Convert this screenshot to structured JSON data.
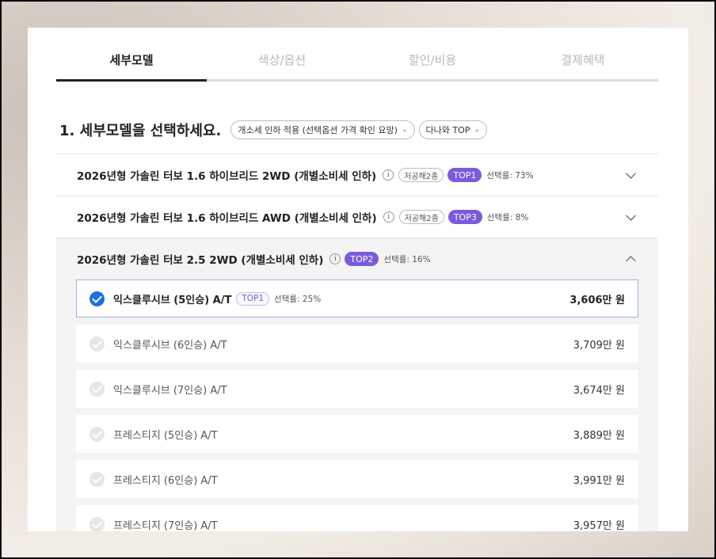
{
  "tabs": [
    {
      "label": "세부모델",
      "active": true
    },
    {
      "label": "색상/옵션",
      "active": false
    },
    {
      "label": "할인/비용",
      "active": false
    },
    {
      "label": "결제혜택",
      "active": false
    }
  ],
  "section": {
    "title": "1. 세부모델을 선택하세요.",
    "filter_tax": "개소세 인하 적용 (선택옵션 가격 확인 요망)",
    "filter_sort": "다나와 TOP"
  },
  "models": [
    {
      "name": "2026년형 가솔린 터보 1.6 하이브리드 2WD (개별소비세 인하)",
      "low_emission": "저공해2종",
      "top": "TOP1",
      "rate": "선택률: 73%"
    },
    {
      "name": "2026년형 가솔린 터보 1.6 하이브리드 AWD (개별소비세 인하)",
      "low_emission": "저공해2종",
      "top": "TOP3",
      "rate": "선택률: 8%"
    },
    {
      "name": "2026년형 가솔린 터보 2.5 2WD (개별소비세 인하)",
      "top": "TOP2",
      "rate": "선택률: 16%"
    }
  ],
  "info_glyph": "i",
  "trims": [
    {
      "name": "익스클루시브 (5인승) A/T",
      "top": "TOP1",
      "rate": "선택률: 25%",
      "price": "3,606만 원",
      "selected": true
    },
    {
      "name": "익스클루시브 (6인승) A/T",
      "price": "3,709만 원"
    },
    {
      "name": "익스클루시브 (7인승) A/T",
      "price": "3,674만 원"
    },
    {
      "name": "프레스티지 (5인승) A/T",
      "price": "3,889만 원"
    },
    {
      "name": "프레스티지 (6인승) A/T",
      "price": "3,991만 원"
    },
    {
      "name": "프레스티지 (7인승) A/T",
      "price": "3,957만 원"
    }
  ],
  "colors": {
    "accent_purple": "#7a5bdc",
    "check_blue": "#1b6fe4"
  }
}
